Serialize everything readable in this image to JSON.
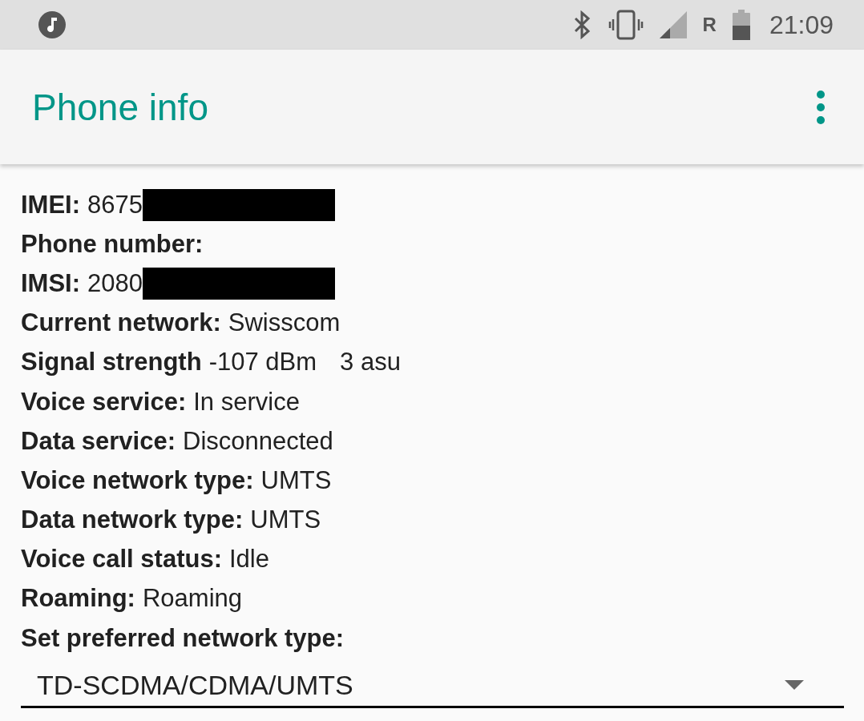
{
  "status_bar": {
    "roaming_indicator": "R",
    "time": "21:09"
  },
  "app_bar": {
    "title": "Phone info"
  },
  "rows": [
    {
      "label": "IMEI:",
      "values": [
        "8675"
      ],
      "redacted": true
    },
    {
      "label": "Phone number:",
      "values": [],
      "redacted": false
    },
    {
      "label": "IMSI:",
      "values": [
        "2080"
      ],
      "redacted": true
    },
    {
      "label": "Current network:",
      "values": [
        "Swisscom"
      ],
      "redacted": false
    },
    {
      "label": "Signal strength",
      "values": [
        "-107 dBm",
        "3 asu"
      ],
      "redacted": false
    },
    {
      "label": "Voice service:",
      "values": [
        "In service"
      ],
      "redacted": false
    },
    {
      "label": "Data service:",
      "values": [
        "Disconnected"
      ],
      "redacted": false
    },
    {
      "label": "Voice network type:",
      "values": [
        "UMTS"
      ],
      "redacted": false
    },
    {
      "label": "Data network type:",
      "values": [
        "UMTS"
      ],
      "redacted": false
    },
    {
      "label": "Voice call status:",
      "values": [
        "Idle"
      ],
      "redacted": false
    },
    {
      "label": "Roaming:",
      "values": [
        "Roaming"
      ],
      "redacted": false
    },
    {
      "label": "Set preferred network type:",
      "values": [],
      "redacted": false
    }
  ],
  "dropdown": {
    "value": "TD-SCDMA/CDMA/UMTS"
  }
}
